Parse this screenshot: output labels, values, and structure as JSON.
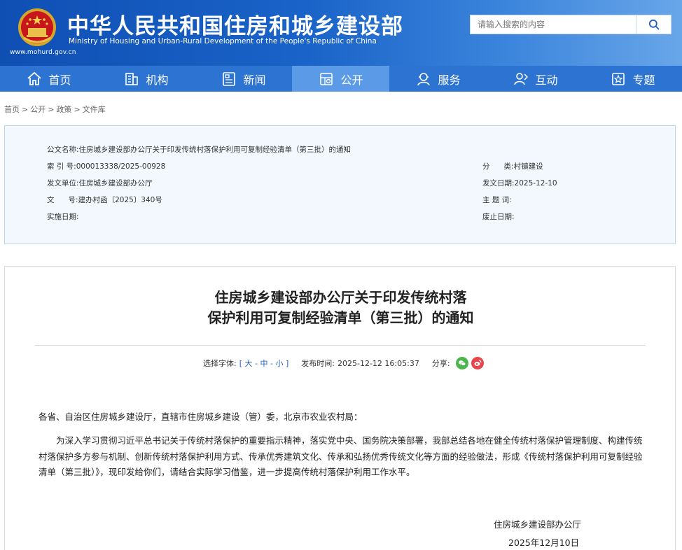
{
  "header": {
    "title": "中华人民共和国住房和城乡建设部",
    "subtitle": "Ministry of Housing and Urban-Rural Development of the People's Republic of China",
    "url": "www.mohurd.gov.cn",
    "search_placeholder": "请输入搜索的内容"
  },
  "nav": {
    "items": [
      {
        "label": "首页",
        "icon": "home-icon"
      },
      {
        "label": "机构",
        "icon": "building-icon"
      },
      {
        "label": "新闻",
        "icon": "news-icon"
      },
      {
        "label": "公开",
        "icon": "disclosure-icon",
        "active": true
      },
      {
        "label": "服务",
        "icon": "service-icon"
      },
      {
        "label": "互动",
        "icon": "interaction-icon"
      },
      {
        "label": "专题",
        "icon": "topic-icon"
      }
    ]
  },
  "breadcrumb": {
    "items": [
      "首页",
      "公开",
      "政策",
      "文件库"
    ],
    "separator": ">"
  },
  "meta": {
    "doc_name_label": "公文名称:",
    "doc_name": "住房城乡建设部办公厅关于印发传统村落保护利用可复制经验清单（第三批）的通知",
    "index_label": "索 引 号:",
    "index": "000013338/2025-00928",
    "issuer_label": "发文单位:",
    "issuer": "住房城乡建设部办公厅",
    "doc_no_label": "文      号:",
    "doc_no": "建办村函〔2025〕340号",
    "impl_date_label": "实施日期:",
    "impl_date": "",
    "category_label": "分      类:",
    "category": "村镇建设",
    "issue_date_label": "发文日期:",
    "issue_date": "2025-12-10",
    "keywords_label": "主 题 词:",
    "keywords": "",
    "expiry_label": "废止日期:",
    "expiry": ""
  },
  "article": {
    "title_line1": "住房城乡建设部办公厅关于印发传统村落",
    "title_line2": "保护利用可复制经验清单（第三批）的通知",
    "font_label": "选择字体:",
    "font_open": "[",
    "font_large": "大",
    "font_medium": "中",
    "font_small": "小",
    "font_dash": "-",
    "font_close": "]",
    "publish_label": "发布时间:",
    "publish_time": "2025-12-12 16:05:37",
    "share_label": "分享:",
    "salutation": "各省、自治区住房城乡建设厅，直辖市住房城乡建设（管）委，北京市农业农村局：",
    "body": "为深入学习贯彻习近平总书记关于传统村落保护的重要指示精神，落实党中央、国务院决策部署，我部总结各地在健全传统村落保护管理制度、构建传统村落保护多方参与机制、创新传统村落保护利用方式、传承优秀建筑文化、传承和弘扬优秀传统文化等方面的经验做法，形成《传统村落保护利用可复制经验清单（第三批）》，现印发给你们，请结合实际学习借鉴，进一步提高传统村落保护利用工作水平。",
    "signature_org": "住房城乡建设部办公厅",
    "signature_date": "2025年12月10日"
  },
  "colors": {
    "header_dark": "#0f4fb4",
    "nav_blue": "#2d74d2",
    "nav_active": "#5b9ae6",
    "meta_bg": "#f2f8fd",
    "wechat": "#4cb64c",
    "weibo": "#e5474d"
  }
}
